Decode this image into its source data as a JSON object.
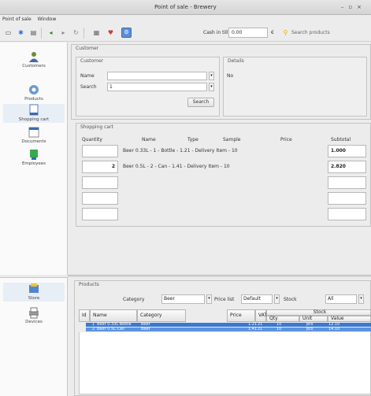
{
  "window": {
    "title": "Point of sale - Brewery"
  },
  "menubar": {
    "items": [
      "Point of sale",
      "Window"
    ]
  },
  "toolbar": {
    "cash_label": "Cash in till",
    "cash_value": "0.00",
    "currency": "€",
    "search_placeholder": "Search products",
    "icons": [
      "new-icon",
      "star-icon",
      "print-icon",
      "back-icon",
      "forward-icon",
      "refresh-icon",
      "grid-icon",
      "heart-icon",
      "settings-icon"
    ]
  },
  "sidebar": {
    "items": [
      {
        "icon": "customers-icon",
        "label": "Customers"
      },
      {
        "icon": "products-icon",
        "label": "Products"
      },
      {
        "icon": "cart-icon",
        "label": "Shopping cart"
      },
      {
        "icon": "documents-icon",
        "label": "Documents"
      },
      {
        "icon": "users-icon",
        "label": "Employees"
      }
    ],
    "bottom_items": [
      {
        "icon": "store-icon",
        "label": "Store"
      },
      {
        "icon": "print-icon",
        "label": "Devices"
      }
    ]
  },
  "customer": {
    "group_title": "Customer",
    "left_title": "Customer",
    "name_label": "Name",
    "name_value": "",
    "search_label": "Search",
    "search_value": "1",
    "search_button": "Search",
    "right_title": "Details",
    "right_value": "No"
  },
  "cart": {
    "group_title": "Shopping cart",
    "headers": [
      "Quantity",
      "Name",
      "Type",
      "Sample",
      "Price",
      "Subtotal"
    ],
    "rows": [
      {
        "qty": "",
        "text": "Beer 0.33L - 1 - Bottle - 1.21 - Delivery Item - 10",
        "subtotal": "1.000"
      },
      {
        "qty": "2",
        "text": "Beer 0.5L - 2 - Can - 1.41 - Delivery Item - 10",
        "subtotal": "2.820"
      }
    ]
  },
  "bottom": {
    "group_title": "Products",
    "filter_label": "Category",
    "filter_value": "Beer",
    "price_label": "Price list",
    "price_value": "Default",
    "stock_label": "Stock",
    "stock_value": "All",
    "headers": [
      "Id",
      "Name",
      "Category",
      "Price",
      "VAT",
      "Stock"
    ],
    "stock_sub": [
      "Qty",
      "Unit",
      "Value"
    ],
    "rows": [
      {
        "id": "1",
        "name": "Beer 0.33L Bottle",
        "category": "Beer",
        "price": "1.21",
        "vat": "21",
        "qty": "10",
        "unit": "pcs",
        "value": "12.10"
      },
      {
        "id": "2",
        "name": "Beer 0.5L Can",
        "category": "Beer",
        "price": "1.41",
        "vat": "21",
        "qty": "10",
        "unit": "pcs",
        "value": "14.10"
      }
    ]
  },
  "colors": {
    "selection": "#3a79d1",
    "selection_alt": "#5b93e0"
  }
}
